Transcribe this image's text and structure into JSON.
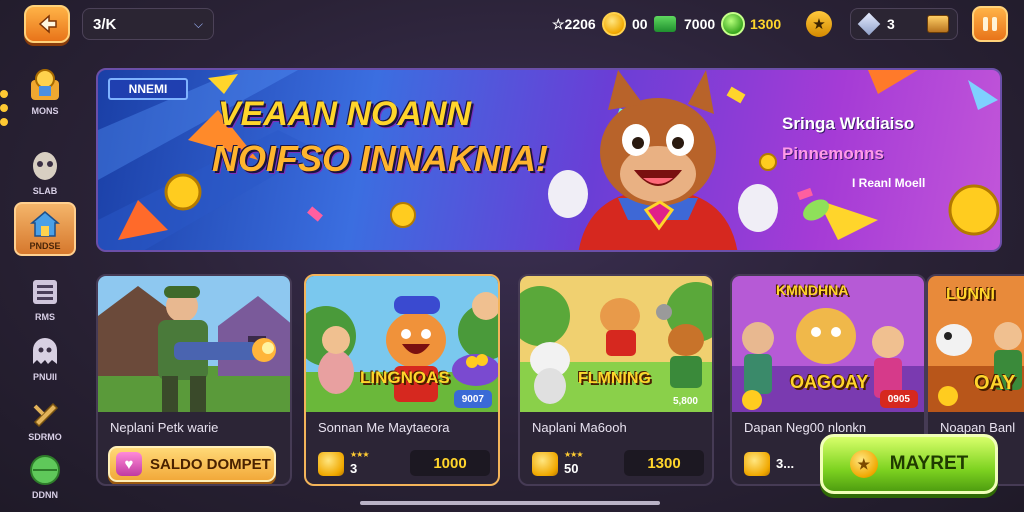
{
  "topbar": {
    "dropdown_value": "3/K",
    "currencies": [
      {
        "icon": "coin-icon",
        "value": "☆2206"
      },
      {
        "icon": "cash-icon",
        "value": "00"
      },
      {
        "icon": "cash-icon",
        "value": "7000"
      },
      {
        "icon": "gem-icon",
        "value": "1300"
      }
    ],
    "crystals": "3"
  },
  "sidebar": {
    "items": [
      {
        "label": "MONS",
        "icon": "shop-icon"
      },
      {
        "label": "SLAB",
        "icon": "mask-icon"
      },
      {
        "label": "PNDSE",
        "icon": "home-icon",
        "active": true
      },
      {
        "label": "RMS",
        "icon": "list-icon"
      },
      {
        "label": "PNUII",
        "icon": "ghost-icon"
      },
      {
        "label": "SDRMO",
        "icon": "wrench-icon"
      },
      {
        "label": "DDNN",
        "icon": "globe-icon"
      }
    ]
  },
  "banner": {
    "badge": "NNEMI",
    "title_line1": "VEAAN NOANN",
    "title_line2": "NOIFSO INNAKNIA!",
    "side_line1": "Sringa Wkdiaiso",
    "side_line2": "Pinnemonns",
    "side_line3": "I Reanl Moell"
  },
  "cards": [
    {
      "name": "Neplani Petk warie",
      "art_title": "",
      "badge": "",
      "stars": "",
      "level": "",
      "value": "",
      "deposit_label": "SALDO DOMPET"
    },
    {
      "name": "Sonnan Me Maytaeora",
      "art_title": "LINGNOAS",
      "badge": "9007",
      "stars": "★★★",
      "level": "3",
      "value": "1000"
    },
    {
      "name": "Naplani Ma6ooh",
      "art_title": "FLMNING",
      "badge": "5,800",
      "stars": "★★★",
      "level": "50",
      "value": "1300"
    },
    {
      "name": "Dapan Neg00 nlonkn",
      "art_title": "OAGOAY",
      "art_title_top": "KMNDHNA",
      "badge": "0905",
      "level": "3..."
    },
    {
      "name": "Noapan Banl",
      "art_title": "OAY",
      "art_title_top": "LUNNI"
    }
  ],
  "play_button": {
    "label": "MAYRET"
  },
  "colors": {
    "accent": "#f2a93a",
    "play": "#7ed321",
    "banner_title": "#ffd52b"
  }
}
